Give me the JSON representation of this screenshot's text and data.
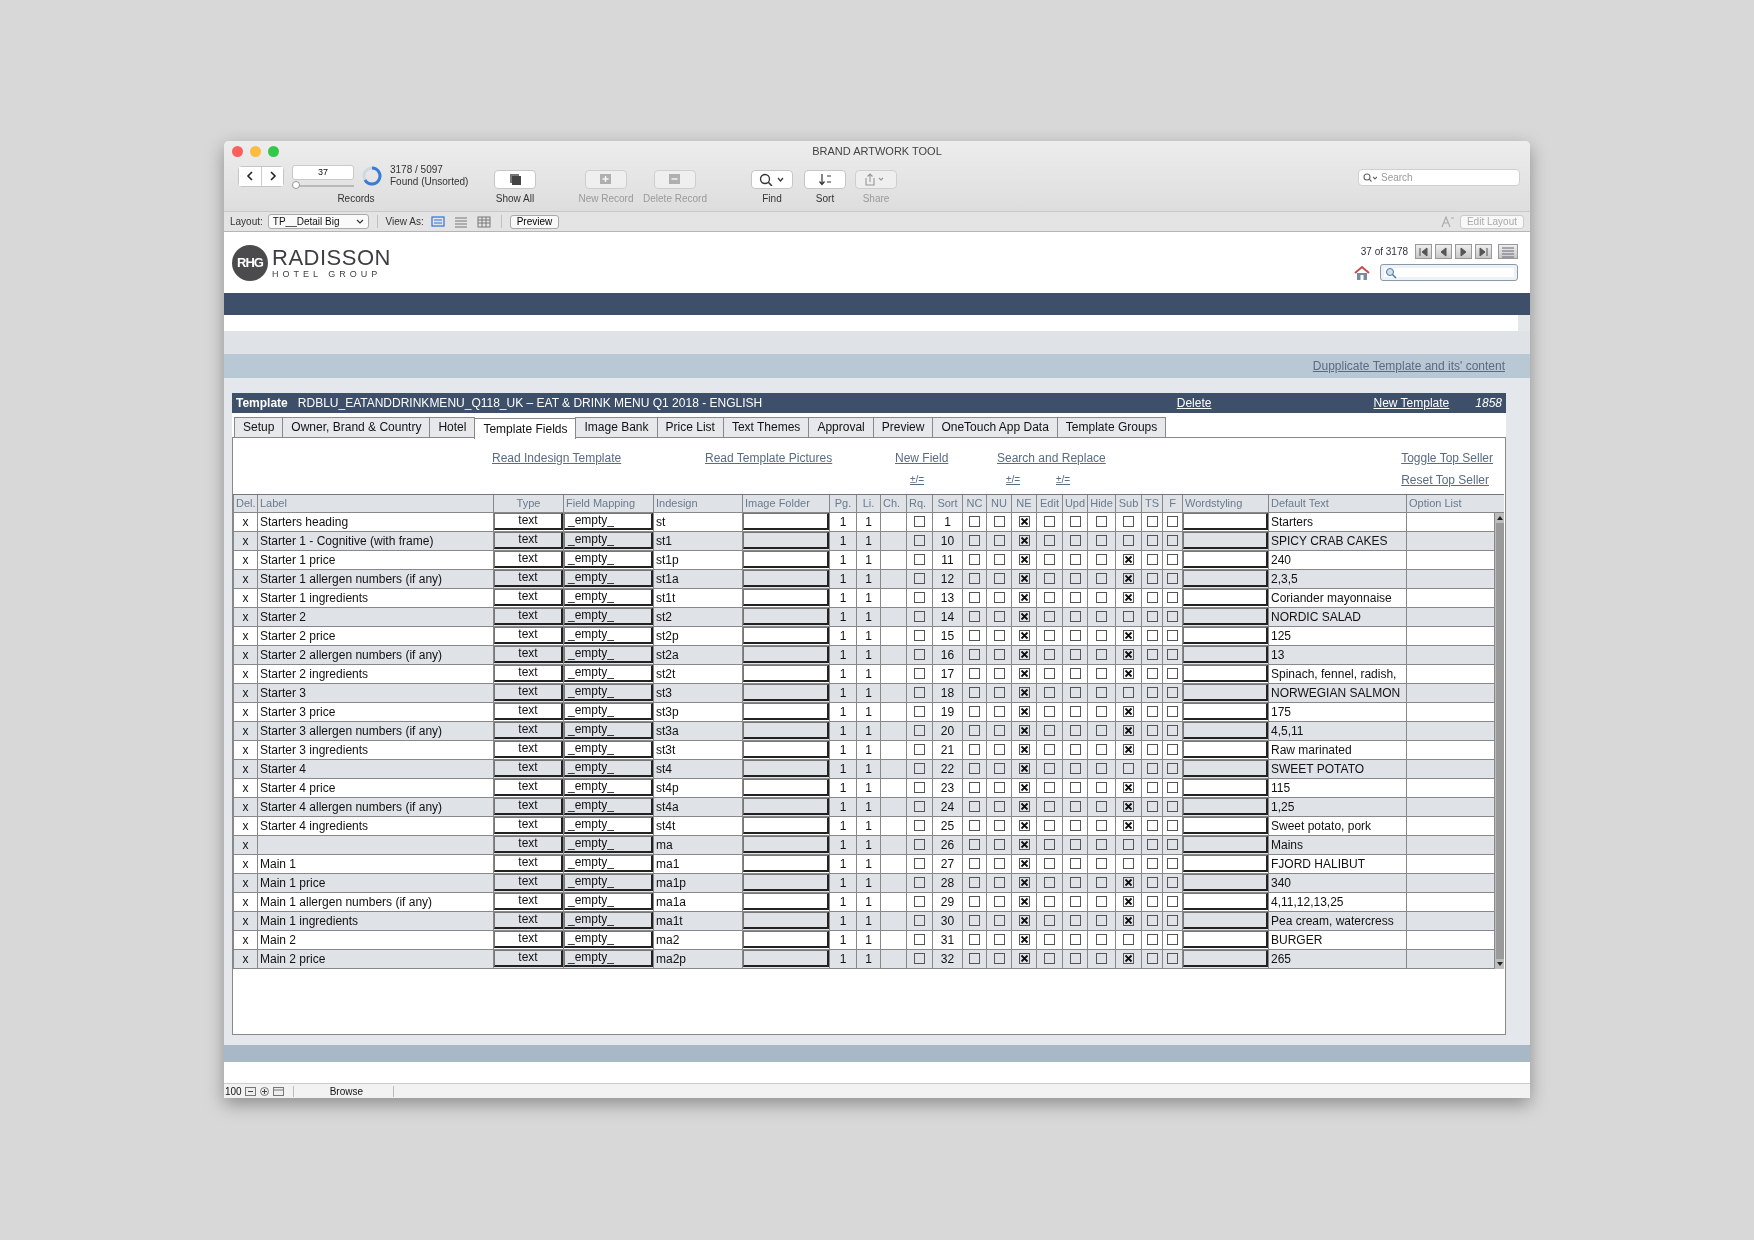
{
  "window": {
    "title": "BRAND ARTWORK TOOL"
  },
  "toolbar": {
    "record_number": "37",
    "record_slider": {
      "level": 0.01
    },
    "found": "3178 / 5097",
    "found_state": "Found (Unsorted)",
    "records_label": "Records",
    "buttons": [
      {
        "kind": "show-all",
        "label": "Show All",
        "disabled": false
      },
      {
        "kind": "new-record",
        "label": "New Record",
        "disabled": true
      },
      {
        "kind": "delete-record",
        "label": "Delete Record",
        "disabled": true
      },
      {
        "kind": "find",
        "label": "Find",
        "disabled": false
      },
      {
        "kind": "sort",
        "label": "Sort",
        "disabled": false
      },
      {
        "kind": "share",
        "label": "Share",
        "disabled": true
      }
    ],
    "search": {
      "placeholder": "Search"
    }
  },
  "layout_bar": {
    "layout_label": "Layout:",
    "layout": "TP__Detail Big",
    "view_as_label": "View As:",
    "views": [
      {
        "kind": "form",
        "selected": true
      },
      {
        "kind": "list",
        "selected": false
      },
      {
        "kind": "table",
        "selected": false
      }
    ],
    "preview_button": "Preview",
    "edit_layout": {
      "label": "Edit Layout",
      "disabled": true
    }
  },
  "header": {
    "logo_mark": "RHG",
    "brand": "RADISSON",
    "brand_sub": "HOTEL GROUP",
    "record_position": "37 of 3178"
  },
  "duplicate_link": "Dupplicate Template and its' content",
  "template": {
    "label": "Template",
    "name": "RDBLU_EATANDDRINKMENU_Q118_UK – EAT & DRINK MENU Q1 2018 - ENGLISH",
    "delete": "Delete",
    "new": "New Template",
    "id": "1858"
  },
  "tabs": [
    {
      "label": "Setup",
      "selected": false
    },
    {
      "label": "Owner, Brand & Country",
      "selected": false
    },
    {
      "label": "Hotel",
      "selected": false
    },
    {
      "label": "Template Fields",
      "selected": true
    },
    {
      "label": "Image Bank",
      "selected": false
    },
    {
      "label": "Price List",
      "selected": false
    },
    {
      "label": "Text Themes",
      "selected": false
    },
    {
      "label": "Approval",
      "selected": false
    },
    {
      "label": "Preview",
      "selected": false
    },
    {
      "label": "OneTouch App Data",
      "selected": false
    },
    {
      "label": "Template Groups",
      "selected": false
    }
  ],
  "actions": {
    "links": [
      "Read Indesign Template",
      "Read Template Pictures",
      "New Field",
      "Search and Replace",
      "Toggle Top Seller"
    ],
    "toggles": [
      "±/=",
      "±/=",
      "±/="
    ],
    "reset": "Reset Top Seller"
  },
  "table": {
    "columns": [
      "Del.",
      "Label",
      "Type",
      "Field Mapping",
      "Indesign",
      "Image Folder",
      "Pg.",
      "Li.",
      "Ch.",
      "Rq.",
      "Sort",
      "NC",
      "NU",
      "NE",
      "Edit",
      "Upd",
      "Hide",
      "Sub",
      "TS",
      "F",
      "Wordstyling",
      "Default Text",
      "Option List"
    ],
    "rows": [
      {
        "del": "x",
        "label": "Starters heading",
        "type": "text",
        "mapping": "_empty_",
        "indesign": "st",
        "page": "1",
        "line": "1",
        "sort": "1",
        "flags": [
          false,
          false,
          false,
          true,
          false,
          false,
          false,
          false,
          false,
          false
        ],
        "default_text": "Starters"
      },
      {
        "del": "x",
        "label": "Starter 1 - Cognitive (with frame)",
        "type": "text",
        "mapping": "_empty_",
        "indesign": "st1",
        "page": "1",
        "line": "1",
        "sort": "10",
        "flags": [
          false,
          false,
          false,
          true,
          false,
          false,
          false,
          false,
          false,
          false
        ],
        "default_text": "SPICY CRAB CAKES"
      },
      {
        "del": "x",
        "label": "Starter 1 price",
        "type": "text",
        "mapping": "_empty_",
        "indesign": "st1p",
        "page": "1",
        "line": "1",
        "sort": "11",
        "flags": [
          false,
          false,
          false,
          true,
          false,
          false,
          false,
          true,
          false,
          false
        ],
        "default_text": "240"
      },
      {
        "del": "x",
        "label": "Starter 1 allergen numbers (if any)",
        "type": "text",
        "mapping": "_empty_",
        "indesign": "st1a",
        "page": "1",
        "line": "1",
        "sort": "12",
        "flags": [
          false,
          false,
          false,
          true,
          false,
          false,
          false,
          true,
          false,
          false
        ],
        "default_text": "2,3,5"
      },
      {
        "del": "x",
        "label": "Starter 1 ingredients",
        "type": "text",
        "mapping": "_empty_",
        "indesign": "st1t",
        "page": "1",
        "line": "1",
        "sort": "13",
        "flags": [
          false,
          false,
          false,
          true,
          false,
          false,
          false,
          true,
          false,
          false
        ],
        "default_text": "Coriander mayonnaise"
      },
      {
        "del": "x",
        "label": "Starter 2",
        "type": "text",
        "mapping": "_empty_",
        "indesign": "st2",
        "page": "1",
        "line": "1",
        "sort": "14",
        "flags": [
          false,
          false,
          false,
          true,
          false,
          false,
          false,
          false,
          false,
          false
        ],
        "default_text": "NORDIC SALAD"
      },
      {
        "del": "x",
        "label": "Starter 2 price",
        "type": "text",
        "mapping": "_empty_",
        "indesign": "st2p",
        "page": "1",
        "line": "1",
        "sort": "15",
        "flags": [
          false,
          false,
          false,
          true,
          false,
          false,
          false,
          true,
          false,
          false
        ],
        "default_text": "125"
      },
      {
        "del": "x",
        "label": "Starter 2 allergen numbers (if any)",
        "type": "text",
        "mapping": "_empty_",
        "indesign": "st2a",
        "page": "1",
        "line": "1",
        "sort": "16",
        "flags": [
          false,
          false,
          false,
          true,
          false,
          false,
          false,
          true,
          false,
          false
        ],
        "default_text": "13"
      },
      {
        "del": "x",
        "label": "Starter 2 ingredients",
        "type": "text",
        "mapping": "_empty_",
        "indesign": "st2t",
        "page": "1",
        "line": "1",
        "sort": "17",
        "flags": [
          false,
          false,
          false,
          true,
          false,
          false,
          false,
          true,
          false,
          false
        ],
        "default_text": "Spinach, fennel, radish,"
      },
      {
        "del": "x",
        "label": "Starter 3",
        "type": "text",
        "mapping": "_empty_",
        "indesign": "st3",
        "page": "1",
        "line": "1",
        "sort": "18",
        "flags": [
          false,
          false,
          false,
          true,
          false,
          false,
          false,
          false,
          false,
          false
        ],
        "default_text": "NORWEGIAN SALMON"
      },
      {
        "del": "x",
        "label": "Starter 3 price",
        "type": "text",
        "mapping": "_empty_",
        "indesign": "st3p",
        "page": "1",
        "line": "1",
        "sort": "19",
        "flags": [
          false,
          false,
          false,
          true,
          false,
          false,
          false,
          true,
          false,
          false
        ],
        "default_text": "175"
      },
      {
        "del": "x",
        "label": "Starter 3 allergen numbers (if any)",
        "type": "text",
        "mapping": "_empty_",
        "indesign": "st3a",
        "page": "1",
        "line": "1",
        "sort": "20",
        "flags": [
          false,
          false,
          false,
          true,
          false,
          false,
          false,
          true,
          false,
          false
        ],
        "default_text": "4,5,11"
      },
      {
        "del": "x",
        "label": "Starter 3 ingredients",
        "type": "text",
        "mapping": "_empty_",
        "indesign": "st3t",
        "page": "1",
        "line": "1",
        "sort": "21",
        "flags": [
          false,
          false,
          false,
          true,
          false,
          false,
          false,
          true,
          false,
          false
        ],
        "default_text": "Raw marinated"
      },
      {
        "del": "x",
        "label": "Starter 4",
        "type": "text",
        "mapping": "_empty_",
        "indesign": "st4",
        "page": "1",
        "line": "1",
        "sort": "22",
        "flags": [
          false,
          false,
          false,
          true,
          false,
          false,
          false,
          false,
          false,
          false
        ],
        "default_text": "SWEET POTATO"
      },
      {
        "del": "x",
        "label": "Starter 4 price",
        "type": "text",
        "mapping": "_empty_",
        "indesign": "st4p",
        "page": "1",
        "line": "1",
        "sort": "23",
        "flags": [
          false,
          false,
          false,
          true,
          false,
          false,
          false,
          true,
          false,
          false
        ],
        "default_text": "115"
      },
      {
        "del": "x",
        "label": "Starter 4 allergen numbers (if any)",
        "type": "text",
        "mapping": "_empty_",
        "indesign": "st4a",
        "page": "1",
        "line": "1",
        "sort": "24",
        "flags": [
          false,
          false,
          false,
          true,
          false,
          false,
          false,
          true,
          false,
          false
        ],
        "default_text": "1,25"
      },
      {
        "del": "x",
        "label": "Starter 4 ingredients",
        "type": "text",
        "mapping": "_empty_",
        "indesign": "st4t",
        "page": "1",
        "line": "1",
        "sort": "25",
        "flags": [
          false,
          false,
          false,
          true,
          false,
          false,
          false,
          true,
          false,
          false
        ],
        "default_text": "Sweet potato, pork"
      },
      {
        "del": "x",
        "type": "text",
        "mapping": "_empty_",
        "indesign": "ma",
        "page": "1",
        "line": "1",
        "sort": "26",
        "flags": [
          false,
          false,
          false,
          true,
          false,
          false,
          false,
          false,
          false,
          false
        ],
        "default_text": "Mains"
      },
      {
        "del": "x",
        "label": "Main 1",
        "type": "text",
        "mapping": "_empty_",
        "indesign": "ma1",
        "page": "1",
        "line": "1",
        "sort": "27",
        "flags": [
          false,
          false,
          false,
          true,
          false,
          false,
          false,
          false,
          false,
          false
        ],
        "default_text": "FJORD HALIBUT"
      },
      {
        "del": "x",
        "label": "Main 1 price",
        "type": "text",
        "mapping": "_empty_",
        "indesign": "ma1p",
        "page": "1",
        "line": "1",
        "sort": "28",
        "flags": [
          false,
          false,
          false,
          true,
          false,
          false,
          false,
          true,
          false,
          false
        ],
        "default_text": "340"
      },
      {
        "del": "x",
        "label": "Main 1 allergen numbers (if any)",
        "type": "text",
        "mapping": "_empty_",
        "indesign": "ma1a",
        "page": "1",
        "line": "1",
        "sort": "29",
        "flags": [
          false,
          false,
          false,
          true,
          false,
          false,
          false,
          true,
          false,
          false
        ],
        "default_text": "4,11,12,13,25"
      },
      {
        "del": "x",
        "label": "Main 1 ingredients",
        "type": "text",
        "mapping": "_empty_",
        "indesign": "ma1t",
        "page": "1",
        "line": "1",
        "sort": "30",
        "flags": [
          false,
          false,
          false,
          true,
          false,
          false,
          false,
          true,
          false,
          false
        ],
        "default_text": "Pea cream, watercress"
      },
      {
        "del": "x",
        "label": "Main 2",
        "type": "text",
        "mapping": "_empty_",
        "indesign": "ma2",
        "page": "1",
        "line": "1",
        "sort": "31",
        "flags": [
          false,
          false,
          false,
          true,
          false,
          false,
          false,
          false,
          false,
          false
        ],
        "default_text": "BURGER"
      },
      {
        "del": "x",
        "label": "Main 2 price",
        "type": "text",
        "mapping": "_empty_",
        "indesign": "ma2p",
        "page": "1",
        "line": "1",
        "sort": "32",
        "flags": [
          false,
          false,
          false,
          true,
          false,
          false,
          false,
          true,
          false,
          false
        ],
        "default_text": "265"
      }
    ]
  },
  "status_bar": {
    "zoom": "100",
    "mode": "Browse"
  }
}
